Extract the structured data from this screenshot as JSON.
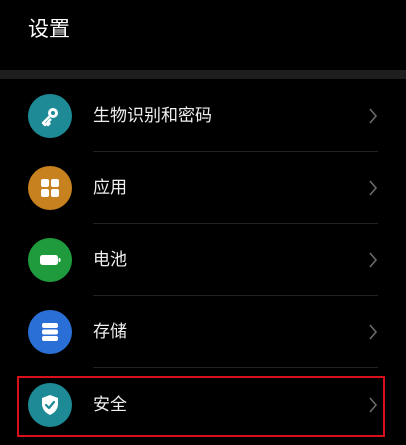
{
  "header": {
    "title": "设置"
  },
  "items": [
    {
      "label": "生物识别和密码",
      "icon": "key-icon",
      "color": "#1d8a96"
    },
    {
      "label": "应用",
      "icon": "apps-grid-icon",
      "color": "#c7811f"
    },
    {
      "label": "电池",
      "icon": "battery-icon",
      "color": "#1f9a3c"
    },
    {
      "label": "存储",
      "icon": "storage-icon",
      "color": "#2a6fd6"
    },
    {
      "label": "安全",
      "icon": "shield-check-icon",
      "color": "#1d8a96"
    }
  ],
  "highlight": {
    "target": "安全",
    "color": "#d7101b"
  }
}
